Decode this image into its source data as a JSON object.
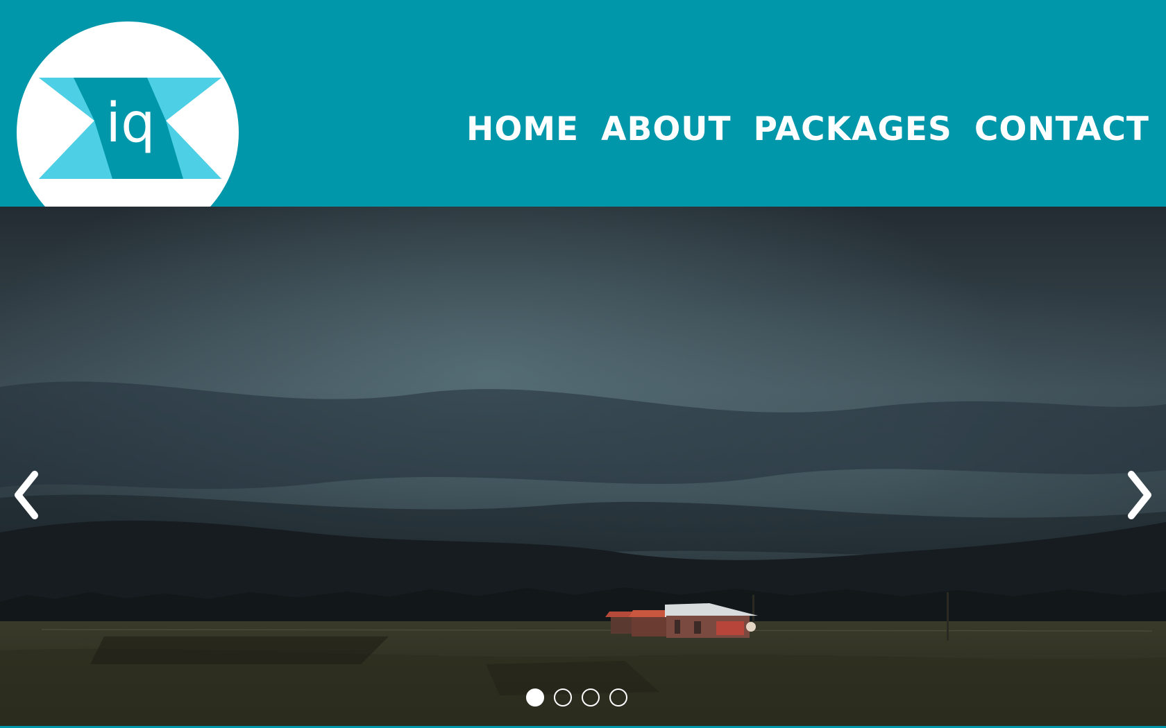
{
  "header": {
    "logo_text": "iq",
    "nav": [
      {
        "label": "HOME"
      },
      {
        "label": "ABOUT"
      },
      {
        "label": "PACKAGES"
      },
      {
        "label": "CONTACT"
      }
    ]
  },
  "slider": {
    "icons": {
      "prev": "chevron-left-icon",
      "next": "chevron-right-icon"
    },
    "slide_count": 4,
    "active_index": 0
  },
  "colors": {
    "brand": "#0197aa",
    "logo_accent": "#4dd0e5",
    "white": "#ffffff"
  }
}
